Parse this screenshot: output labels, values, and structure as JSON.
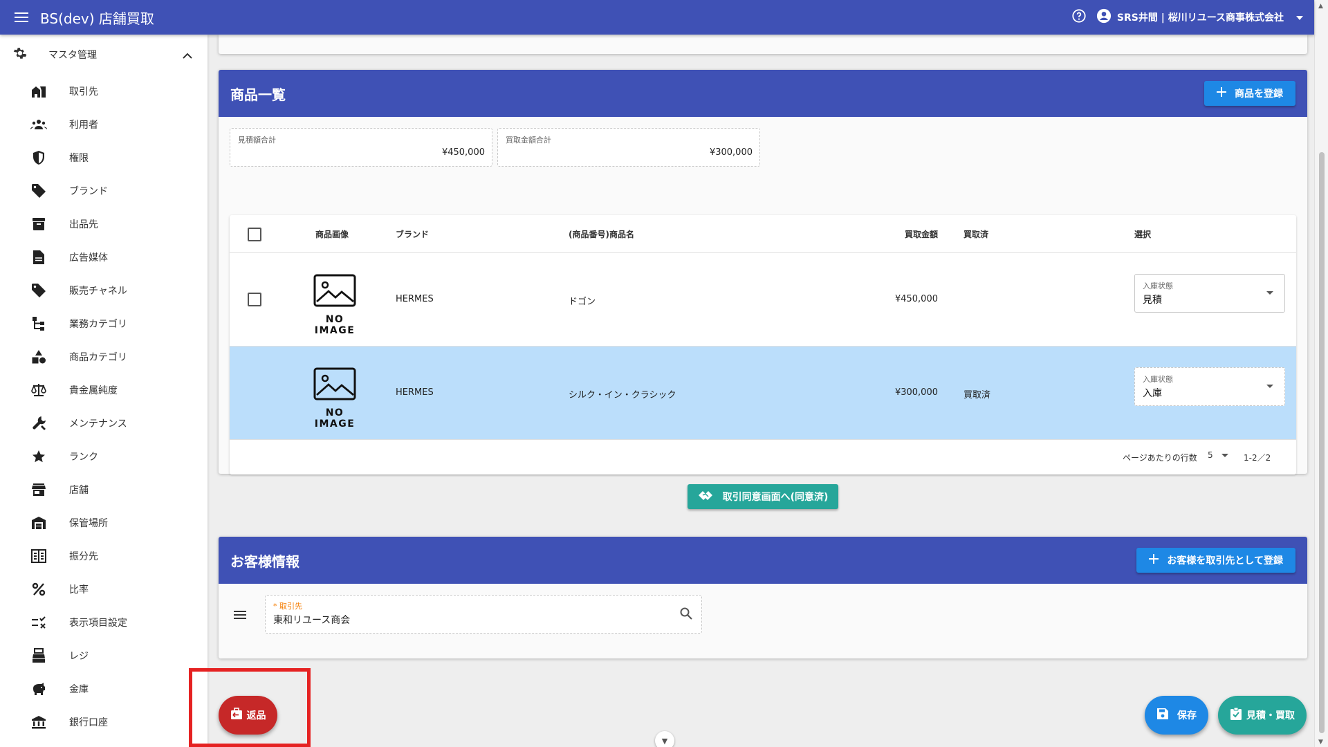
{
  "app": {
    "title": "BS(dev) 店舗買取",
    "user": "SRS井間 | 桜川リユース商事株式会社"
  },
  "sidebar": {
    "group_label": "マスタ管理",
    "items": [
      {
        "label": "取引先",
        "icon": "business-icon"
      },
      {
        "label": "利用者",
        "icon": "people-icon"
      },
      {
        "label": "権限",
        "icon": "shield-icon"
      },
      {
        "label": "ブランド",
        "icon": "tag-icon"
      },
      {
        "label": "出品先",
        "icon": "archive-icon"
      },
      {
        "label": "広告媒体",
        "icon": "document-icon"
      },
      {
        "label": "販売チャネル",
        "icon": "tag-icon"
      },
      {
        "label": "業務カテゴリ",
        "icon": "tree-icon"
      },
      {
        "label": "商品カテゴリ",
        "icon": "category-icon"
      },
      {
        "label": "貴金属純度",
        "icon": "scale-icon"
      },
      {
        "label": "メンテナンス",
        "icon": "tools-icon"
      },
      {
        "label": "ランク",
        "icon": "star-icon"
      },
      {
        "label": "店舗",
        "icon": "store-icon"
      },
      {
        "label": "保管場所",
        "icon": "warehouse-icon"
      },
      {
        "label": "振分先",
        "icon": "ledger-icon"
      },
      {
        "label": "比率",
        "icon": "percent-icon"
      },
      {
        "label": "表示項目設定",
        "icon": "rule-icon"
      },
      {
        "label": "レジ",
        "icon": "register-icon"
      },
      {
        "label": "金庫",
        "icon": "piggy-bank-icon"
      },
      {
        "label": "銀行口座",
        "icon": "bank-icon"
      }
    ]
  },
  "products": {
    "title": "商品一覧",
    "add_button": "商品を登録",
    "estimate_total_label": "見積額合計",
    "estimate_total_value": "¥450,000",
    "purchase_total_label": "買取金額合計",
    "purchase_total_value": "¥300,000",
    "columns": {
      "image": "商品画像",
      "brand": "ブランド",
      "name": "(商品番号)商品名",
      "amount": "買取金額",
      "purchased": "買取済",
      "select": "選択"
    },
    "no_image": "NO IMAGE",
    "select_label": "入庫状態",
    "rows": [
      {
        "brand": "HERMES",
        "name": "ドゴン",
        "amount": "¥450,000",
        "purchased": "",
        "status": "見積"
      },
      {
        "brand": "HERMES",
        "name": "シルク・イン・クラシック",
        "amount": "¥300,000",
        "purchased": "買取済",
        "status": "入庫"
      }
    ],
    "rows_per_page_label": "ページあたりの行数",
    "rows_per_page": "5",
    "range": "1-2／2"
  },
  "agreement_button": "取引同意画面へ(同意済)",
  "customer": {
    "title": "お客様情報",
    "register_button": "お客様を取引先として登録",
    "field_required": "*",
    "field_label": "取引先",
    "field_value": "東和リユース商会"
  },
  "actions": {
    "return": "返品",
    "save": "保存",
    "estimate": "見積・買取"
  },
  "colors": {
    "primary": "#3f51b5",
    "accent_blue": "#1e88e5",
    "teal": "#26a69a",
    "danger": "#c62828",
    "selected_row": "#bbdefb"
  }
}
